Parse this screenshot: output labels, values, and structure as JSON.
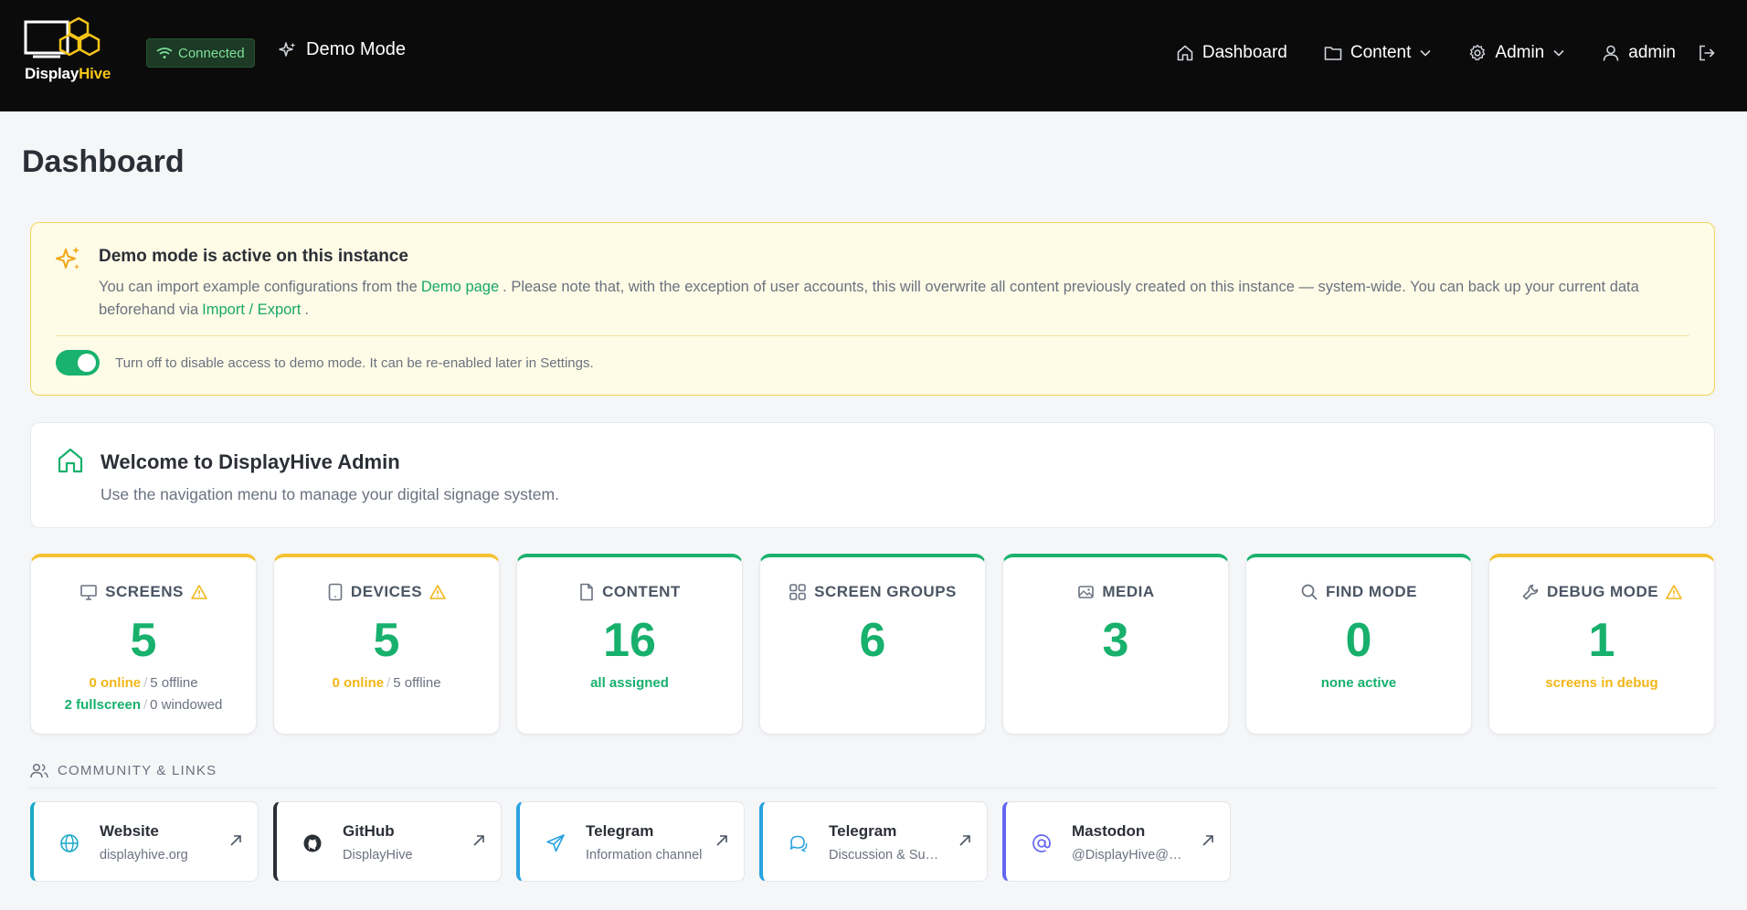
{
  "header": {
    "logo_display": "Display",
    "logo_hive": "Hive",
    "connection_status": "Connected",
    "demo_mode_label": "Demo Mode",
    "nav": {
      "dashboard": "Dashboard",
      "content": "Content",
      "admin": "Admin",
      "user": "admin"
    }
  },
  "page": {
    "title": "Dashboard"
  },
  "demo_notice": {
    "title": "Demo mode is active on this instance",
    "text_1": "You can import example configurations from the",
    "link_demo": "Demo page",
    "text_2": ". Please note that, with the exception of user accounts, this will overwrite all content previously created on this instance — system-wide. You can back up your current data beforehand via",
    "link_import": "Import / Export",
    "text_3": ".",
    "toggle_label": "Turn off to disable access to demo mode. It can be re-enabled later in Settings.",
    "toggle_on": true
  },
  "welcome": {
    "title": "Welcome to DisplayHive Admin",
    "subtitle": "Use the navigation menu to manage your digital signage system."
  },
  "stats": [
    {
      "key": "screens",
      "label": "SCREENS",
      "value": "5",
      "warning": true,
      "line1_a": "0 online",
      "line1_b": "5 offline",
      "line2_a": "2 fullscreen",
      "line2_b": "0 windowed"
    },
    {
      "key": "devices",
      "label": "DEVICES",
      "value": "5",
      "warning": true,
      "line1_a": "0 online",
      "line1_b": "5 offline"
    },
    {
      "key": "content",
      "label": "CONTENT",
      "value": "16",
      "warning": false,
      "note": "all assigned"
    },
    {
      "key": "screen_groups",
      "label": "SCREEN GROUPS",
      "value": "6",
      "warning": false
    },
    {
      "key": "media",
      "label": "MEDIA",
      "value": "3",
      "warning": false
    },
    {
      "key": "find_mode",
      "label": "FIND MODE",
      "value": "0",
      "warning": false,
      "note": "none active"
    },
    {
      "key": "debug_mode",
      "label": "DEBUG MODE",
      "value": "1",
      "warning": true,
      "note": "screens in debug"
    }
  ],
  "community": {
    "heading": "COMMUNITY & LINKS",
    "links": [
      {
        "title": "Website",
        "subtitle": "displayhive.org",
        "icon": "globe-icon",
        "accent": "#1aa9c9"
      },
      {
        "title": "GitHub",
        "subtitle": "DisplayHive",
        "icon": "github-icon",
        "accent": "#2b2f36"
      },
      {
        "title": "Telegram",
        "subtitle": "Information channel",
        "icon": "send-icon",
        "accent": "#2aa3e0"
      },
      {
        "title": "Telegram",
        "subtitle": "Discussion & Support",
        "icon": "chat-icon",
        "accent": "#2aa3e0"
      },
      {
        "title": "Mastodon",
        "subtitle": "@DisplayHive@mastodon",
        "icon": "at-icon",
        "accent": "#6366f1"
      }
    ]
  },
  "colors": {
    "accent_green": "#17b06c",
    "warning_yellow": "#f2b619",
    "header_bg": "#0b0b0c"
  }
}
